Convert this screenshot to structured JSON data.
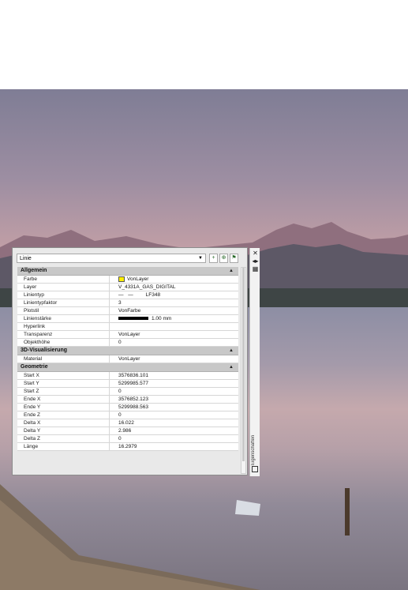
{
  "palette": {
    "object_type": "Linie",
    "rail_title": "Eigenschaften",
    "sections": [
      {
        "title": "Allgemein",
        "rows": [
          {
            "key": "Farbe",
            "value": "VonLayer"
          },
          {
            "key": "Layer",
            "value": "V_4331A_GAS_DIGITAL"
          },
          {
            "key": "Linientyp",
            "value": "LF348"
          },
          {
            "key": "Linientypfaktor",
            "value": "3"
          },
          {
            "key": "Plotstil",
            "value": "VonFarbe"
          },
          {
            "key": "Linienstärke",
            "value": "1.00 mm"
          },
          {
            "key": "Hyperlink",
            "value": ""
          },
          {
            "key": "Transparenz",
            "value": "VonLayer"
          },
          {
            "key": "Objekthöhe",
            "value": "0"
          }
        ]
      },
      {
        "title": "3D-Visualisierung",
        "rows": [
          {
            "key": "Material",
            "value": "VonLayer"
          }
        ]
      },
      {
        "title": "Geometrie",
        "rows": [
          {
            "key": "Start X",
            "value": "3576836.101"
          },
          {
            "key": "Start Y",
            "value": "5299985.577"
          },
          {
            "key": "Start Z",
            "value": "0"
          },
          {
            "key": "Ende X",
            "value": "3576852.123"
          },
          {
            "key": "Ende Y",
            "value": "5299988.563"
          },
          {
            "key": "Ende Z",
            "value": "0"
          },
          {
            "key": "Delta X",
            "value": "16.022"
          },
          {
            "key": "Delta Y",
            "value": "2.986"
          },
          {
            "key": "Delta Z",
            "value": "0"
          },
          {
            "key": "Länge",
            "value": "16.2979"
          }
        ]
      }
    ]
  },
  "colors": {
    "farbe_swatch": "#ffee00"
  }
}
